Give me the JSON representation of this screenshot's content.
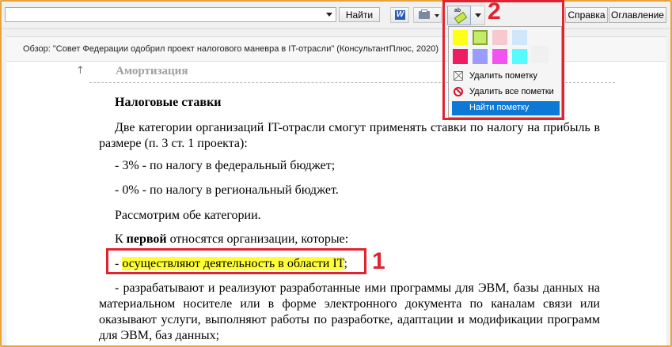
{
  "toolbar": {
    "search_value": "",
    "find_label": "Найти",
    "word_label": "W",
    "help_label": "Справка",
    "contents_label": "Оглавление"
  },
  "document": {
    "title": "Обзор: \"Совет Федерации одобрил проект налогового маневра в IT-отрасли\" (КонсультантПлюс, 2020)",
    "section_title": "Амортизация",
    "heading": "Налоговые ставки",
    "para1": "Две категории организаций IT-отрасли смогут применять ставки по налогу на прибыль в размере (п. 3 ст. 1 проекта):",
    "para2": "- 3% - по налогу в федеральный бюджет;",
    "para3": "- 0% - по налогу в региональный бюджет.",
    "para4": "Рассмотрим обе категории.",
    "para5_prefix": "К ",
    "para5_bold": "первой",
    "para5_suffix": " относятся организации, которые:",
    "para6_prefix": "- ",
    "para6_highlight": "осуществляют деятельность в области IT",
    "para6_suffix": ";",
    "para7": "- разрабатывают и реализуют разработанные ими программы для ЭВМ, базы данных на материальном носителе или в форме электронного документа по каналам связи или оказывают услуги, выполняют работы по разработке, адаптации и модификации программ для ЭВМ, баз данных;"
  },
  "marker_popup": {
    "colors_row1": [
      "#ffff1a",
      "#c4ec6a",
      "#f7c9cf",
      "#cfe6fb"
    ],
    "colors_row2": [
      "#ee1c62",
      "#9a9aff",
      "#f253f0",
      "#55fbff",
      "#f0f0f0"
    ],
    "selected_color": "#c4ec6a",
    "remove_label": "Удалить пометку",
    "remove_all_label": "Удалить все пометки",
    "find_label": "Найти пометку"
  },
  "callouts": {
    "one": "1",
    "two": "2"
  },
  "colors": {
    "highlight": "#ffff33",
    "callout_red": "#e1232f",
    "menu_selected": "#0e78d6"
  }
}
